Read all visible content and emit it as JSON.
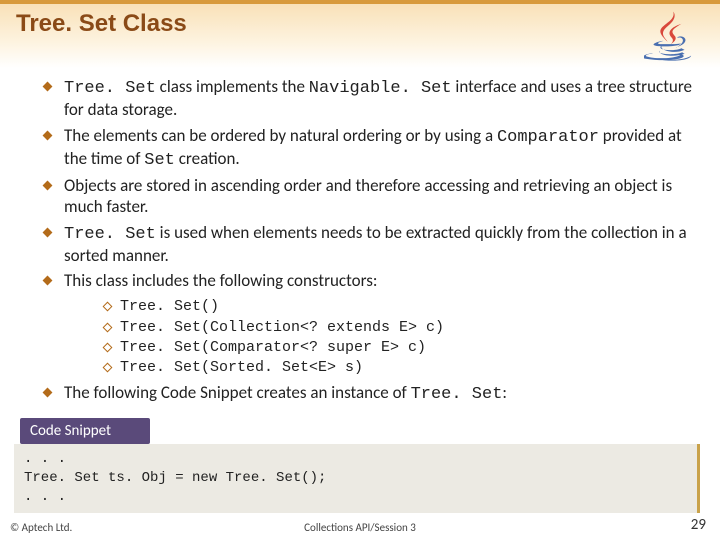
{
  "header": {
    "title": "Tree. Set Class"
  },
  "bullets": {
    "b1_pre": "Tree. Set",
    "b1_mid1": " class implements the ",
    "b1_code2": "Navigable. Set",
    "b1_mid2": " interface and uses a tree structure for data storage.",
    "b2_pre": "The elements can be ordered by natural ordering or by using a ",
    "b2_code": "Comparator",
    "b2_mid": " provided at the time of ",
    "b2_code2": "Set",
    "b2_post": " creation.",
    "b3": "Objects are stored in ascending order and therefore accessing and retrieving an object is much faster.",
    "b4_code": "Tree. Set",
    "b4_post": " is used when elements needs to be extracted quickly from the collection in a sorted manner.",
    "b5": "This class includes the following constructors:",
    "b6_pre": "The following Code Snippet creates an instance of ",
    "b6_code": "Tree. Set",
    "b6_post": ":"
  },
  "constructors": {
    "c1": "Tree. Set()",
    "c2": "Tree. Set(Collection<? extends E> c)",
    "c3": "Tree. Set(Comparator<? super E> c)",
    "c4": "Tree. Set(Sorted. Set<E> s)"
  },
  "snippet": {
    "label": "Code Snippet",
    "body": ". . .\nTree. Set ts. Obj = new Tree. Set();\n. . ."
  },
  "footer": {
    "left": "© Aptech Ltd.",
    "center": "Collections API/Session 3",
    "right": "29"
  }
}
